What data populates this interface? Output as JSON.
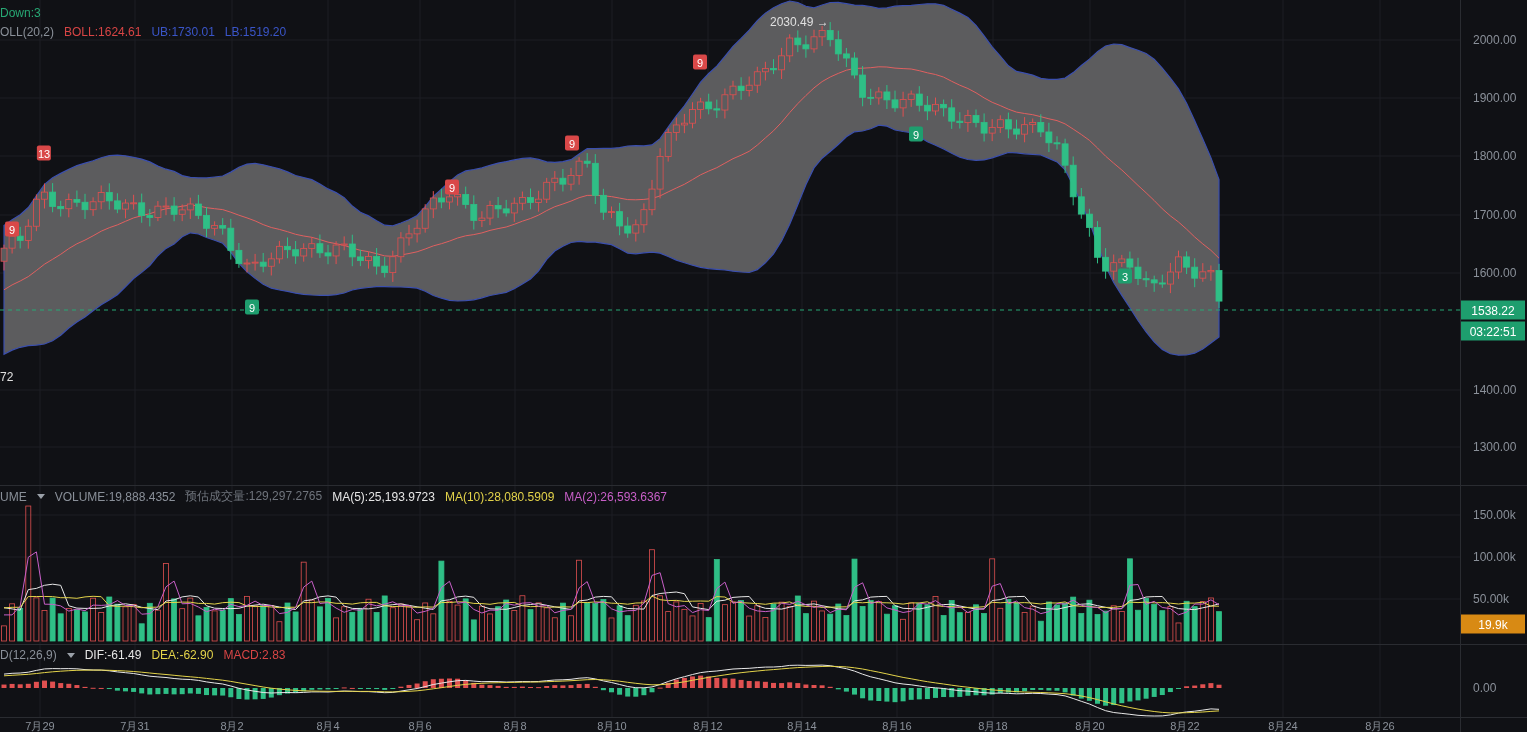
{
  "price_pane": {
    "header": {
      "status": "Down:3",
      "indicator": "OLL(20,2)",
      "boll": "BOLL:1624.61",
      "ub": "UB:1730.01",
      "lb": "LB:1519.20"
    },
    "high_label": "2030.49 →",
    "low_label": "72",
    "signals": [
      {
        "label": "9",
        "color": "#d94848"
      },
      {
        "label": "13",
        "color": "#d94848"
      },
      {
        "label": "9",
        "color": "#1e9e6e"
      },
      {
        "label": "9",
        "color": "#d94848"
      },
      {
        "label": "9",
        "color": "#d94848"
      },
      {
        "label": "9",
        "color": "#d94848"
      },
      {
        "label": "9",
        "color": "#1e9e6e"
      },
      {
        "label": "3",
        "color": "#1e9e6e"
      }
    ],
    "y_ticks": [
      "2000.00",
      "1900.00",
      "1800.00",
      "1700.00",
      "1600.00",
      "1400.00",
      "1300.00"
    ],
    "last_price": "1538.22",
    "countdown": "03:22:51"
  },
  "volume_pane": {
    "header": {
      "indicator": "UME",
      "volume": "VOLUME:19,888.4352",
      "estimate": "预估成交量:129,297.2765",
      "ma5": "MA(5):25,193.9723",
      "ma10": "MA(10):28,080.5909",
      "ma2": "MA(2):26,593.6367"
    },
    "y_ticks": [
      "150.00k",
      "100.00k",
      "50.00k"
    ],
    "last_volume": "19.9k"
  },
  "macd_pane": {
    "header": {
      "indicator": "D(12,26,9)",
      "dif": "DIF:-61.49",
      "dea": "DEA:-62.90",
      "macd": "MACD:2.83"
    },
    "y_ticks": [
      "0.00"
    ]
  },
  "x_axis": {
    "labels": [
      "7月29",
      "7月31",
      "8月2",
      "8月4",
      "8月6",
      "8月8",
      "8月10",
      "8月12",
      "8月14",
      "8月16",
      "8月18",
      "8月20",
      "8月22",
      "8月24",
      "8月26"
    ]
  }
}
